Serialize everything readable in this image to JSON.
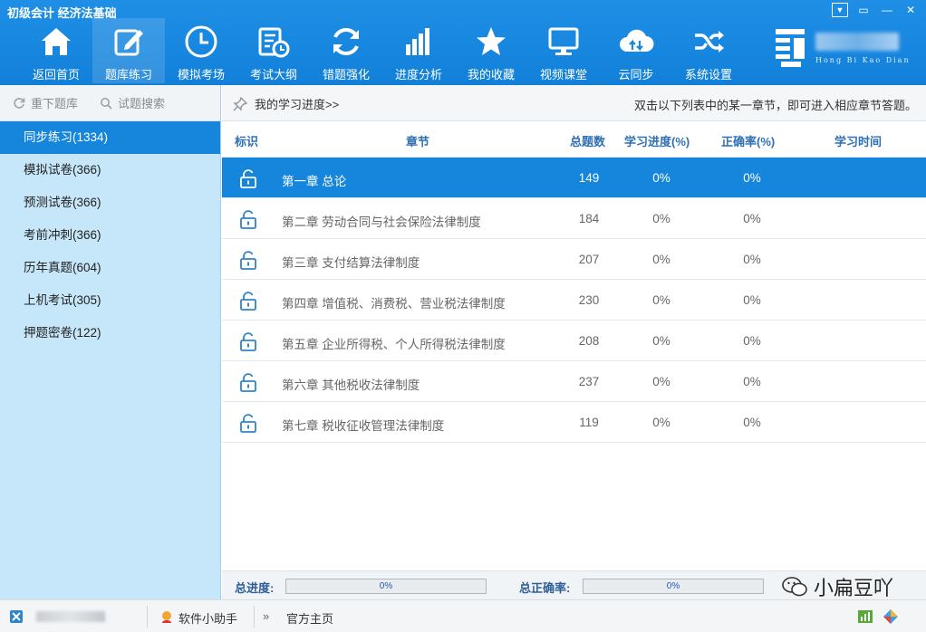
{
  "app": {
    "title": "初级会计 经济法基础",
    "brand_caption": "Hong Bi Kao Dian"
  },
  "toolbar": [
    {
      "label": "返回首页",
      "icon": "home-icon"
    },
    {
      "label": "题库练习",
      "icon": "edit-icon"
    },
    {
      "label": "模拟考场",
      "icon": "clock-icon"
    },
    {
      "label": "考试大纲",
      "icon": "schedule-icon"
    },
    {
      "label": "错题强化",
      "icon": "refresh-icon"
    },
    {
      "label": "进度分析",
      "icon": "bar-chart-icon"
    },
    {
      "label": "我的收藏",
      "icon": "star-icon"
    },
    {
      "label": "视频课堂",
      "icon": "monitor-icon"
    },
    {
      "label": "云同步",
      "icon": "cloud-sync-icon"
    },
    {
      "label": "系统设置",
      "icon": "shuffle-icon"
    }
  ],
  "left": {
    "reload_label": "重下题库",
    "search_label": "试题搜索",
    "categories": [
      "同步练习(1334)",
      "模拟试卷(366)",
      "预测试卷(366)",
      "考前冲刺(366)",
      "历年真题(604)",
      "上机考试(305)",
      "押题密卷(122)"
    ]
  },
  "main": {
    "progress_link": "我的学习进度>>",
    "hint": "双击以下列表中的某一章节，即可进入相应章节答题。",
    "columns": {
      "mark": "标识",
      "chapter": "章节",
      "count": "总题数",
      "progress": "学习进度(%)",
      "accuracy": "正确率(%)",
      "time": "学习时间"
    },
    "rows": [
      {
        "title": "第一章 总论",
        "count": "149",
        "progress": "0%",
        "accuracy": "0%",
        "time": ""
      },
      {
        "title": "第二章 劳动合同与社会保险法律制度",
        "count": "184",
        "progress": "0%",
        "accuracy": "0%",
        "time": ""
      },
      {
        "title": "第三章 支付结算法律制度",
        "count": "207",
        "progress": "0%",
        "accuracy": "0%",
        "time": ""
      },
      {
        "title": "第四章 增值税、消费税、营业税法律制度",
        "count": "230",
        "progress": "0%",
        "accuracy": "0%",
        "time": ""
      },
      {
        "title": "第五章 企业所得税、个人所得税法律制度",
        "count": "208",
        "progress": "0%",
        "accuracy": "0%",
        "time": ""
      },
      {
        "title": "第六章 其他税收法律制度",
        "count": "237",
        "progress": "0%",
        "accuracy": "0%",
        "time": ""
      },
      {
        "title": "第七章 税收征收管理法律制度",
        "count": "119",
        "progress": "0%",
        "accuracy": "0%",
        "time": ""
      }
    ],
    "total_progress_label": "总进度:",
    "total_progress_value": "0%",
    "total_accuracy_label": "总正确率:",
    "total_accuracy_value": "0%"
  },
  "status": {
    "assistant_label": "软件小助手",
    "homepage_label": "官方主页"
  },
  "watermark": "小扁豆吖",
  "colors": {
    "accent": "#1686dc",
    "topbar": "#1a88e0",
    "left_panel": "#c5e7f9"
  }
}
